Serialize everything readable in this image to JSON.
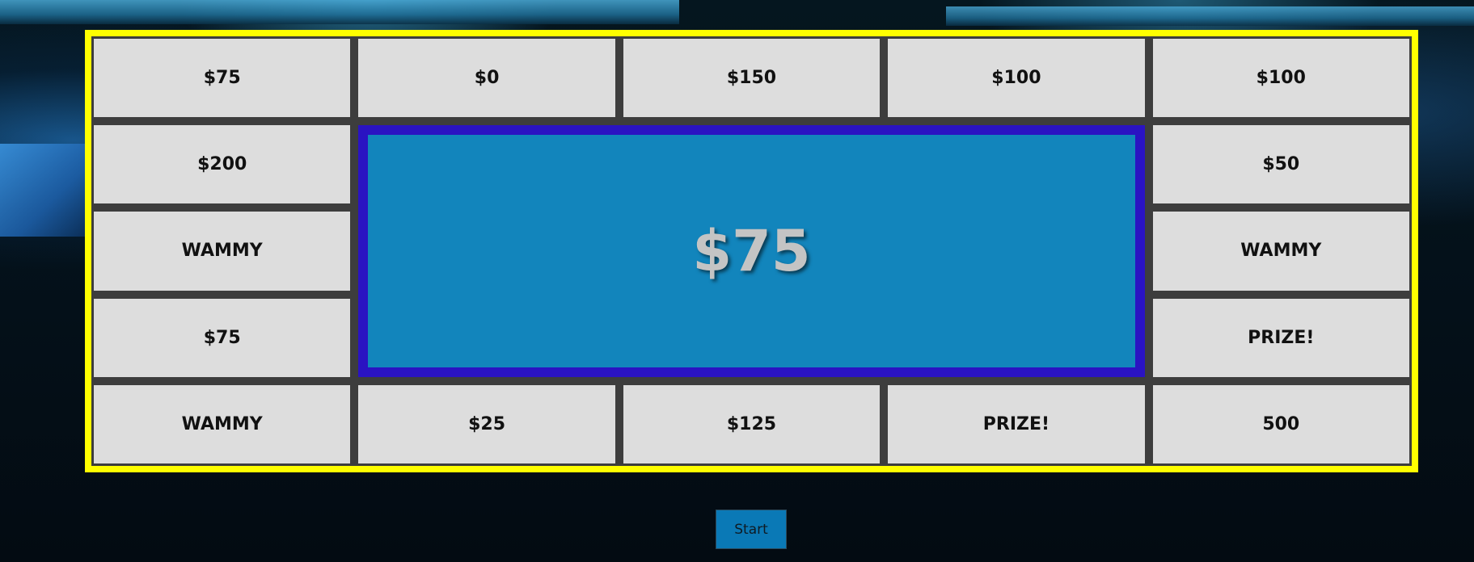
{
  "board": {
    "border_color": "#ffff00",
    "tile_color": "#dddddd",
    "grid_color": "#3d3d3d",
    "top_row": [
      "$75",
      "$0",
      "$150",
      "$100",
      "$100"
    ],
    "left_column": [
      "$200",
      "WAMMY",
      "$75"
    ],
    "right_column": [
      "$50",
      "WAMMY",
      "PRIZE!"
    ],
    "bottom_row": [
      "WAMMY",
      "$25",
      "$125",
      "PRIZE!",
      "500"
    ]
  },
  "center_display": {
    "value": "$75",
    "frame_color": "#2a13c2",
    "screen_color": "#1285bc"
  },
  "start_button": {
    "label": "Start",
    "color": "#0a79b6"
  }
}
